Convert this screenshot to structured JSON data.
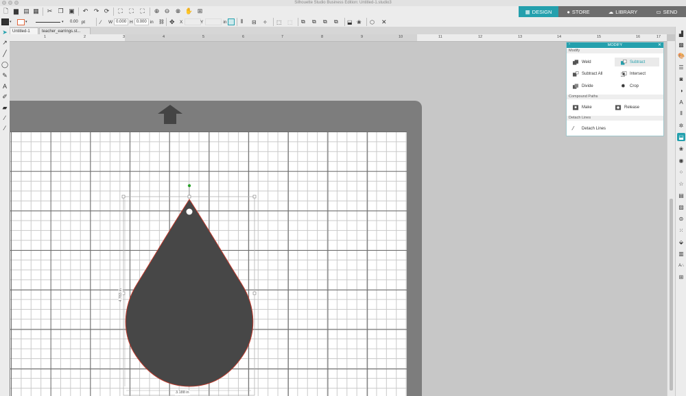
{
  "window": {
    "title": "Silhouette Studio Business Edition: Untitled-1.studio3"
  },
  "nav": {
    "design": "DESIGN",
    "store": "STORE",
    "library": "LIBRARY",
    "send": "SEND",
    "active": "DESIGN",
    "accent": "#24a0ad"
  },
  "line_toolbar": {
    "line_width_value": "0.00",
    "line_width_unit": "pt",
    "w_label": "W",
    "w_value": "0.000",
    "h_label": "H",
    "h_value": "0.000",
    "size_unit": "in",
    "x_label": "X",
    "y_label": "Y",
    "pos_unit": "in"
  },
  "doc_tabs": [
    {
      "label": "Untitled-1"
    },
    {
      "label": "teacher_earrings.st..."
    }
  ],
  "rulers": {
    "h_numbers": [
      "1",
      "2",
      "3",
      "4",
      "5",
      "6",
      "7",
      "8",
      "9",
      "10",
      "11",
      "12",
      "13",
      "14",
      "15",
      "16",
      "17"
    ]
  },
  "modify_panel": {
    "title": "MODIFY",
    "modify_section": "Modify",
    "weld": "Weld",
    "subtract": "Subtract",
    "subtract_all": "Subtract All",
    "intersect": "Intersect",
    "divide": "Divide",
    "crop": "Crop",
    "compound_section": "Compound Paths",
    "make": "Make",
    "release": "Release",
    "detach_section": "Detach Lines",
    "detach_lines": "Detach Lines",
    "selected": "Subtract"
  },
  "shape": {
    "height_label": "4.783 in",
    "width_label": "3.188 in",
    "fill": "#474747",
    "stroke": "#c0392b"
  }
}
